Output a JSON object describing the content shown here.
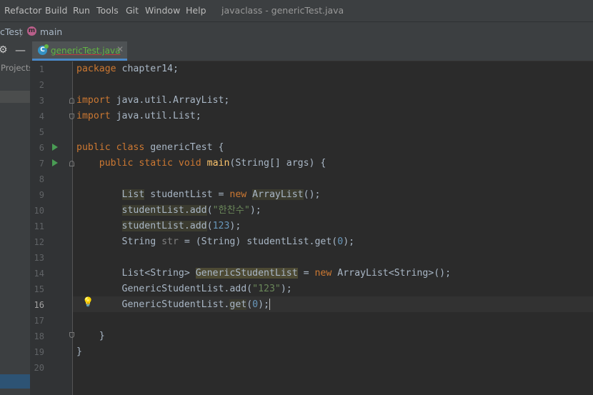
{
  "menu": {
    "items": [
      "Refactor",
      "Build",
      "Run",
      "Tools",
      "Git",
      "Window",
      "Help"
    ],
    "window_title": "javaclass - genericTest.java"
  },
  "breadcrumb": {
    "class": "cTest",
    "method": "main"
  },
  "toolwindow": {
    "label": "Projects"
  },
  "editor": {
    "tab_name": "genericTest.java",
    "line_numbers": [
      "1",
      "2",
      "3",
      "4",
      "5",
      "6",
      "7",
      "8",
      "9",
      "10",
      "11",
      "12",
      "13",
      "14",
      "15",
      "16",
      "17",
      "18",
      "19",
      "20"
    ],
    "current_line": 16
  },
  "code": {
    "l1_kw": "package",
    "l1_rest": " chapter14;",
    "l3_kw": "import",
    "l3_rest": " java.util.ArrayList;",
    "l4_kw": "import",
    "l4_rest": " java.util.List;",
    "l6_kw": "public class",
    "l6_rest": " genericTest {",
    "l7_kw": "    public static void ",
    "l7_fn": "main",
    "l7_rest": "(String[] args) {",
    "l9_a": "        ",
    "l9_b": "List",
    "l9_c": " studentList = ",
    "l9_d": "new ",
    "l9_e": "ArrayList",
    "l9_f": "();",
    "l10_a": "        ",
    "l10_b": "studentList.add",
    "l10_c": "(",
    "l10_d": "\"한찬수\"",
    "l10_e": ");",
    "l11_a": "        ",
    "l11_b": "studentList.add",
    "l11_c": "(",
    "l11_d": "123",
    "l11_e": ");",
    "l12_a": "        String ",
    "l12_b": "str",
    "l12_c": " = (String) studentList.get(",
    "l12_d": "0",
    "l12_e": ");",
    "l14_a": "        List<String> ",
    "l14_b": "GenericStudentList",
    "l14_c": " = ",
    "l14_d": "new ",
    "l14_e": "ArrayList<String>();",
    "l15_a": "        GenericStudentList.add(",
    "l15_b": "\"123\"",
    "l15_c": ");",
    "l16_a": "        GenericStudentList.",
    "l16_b": "get",
    "l16_c": "(",
    "l16_d": "0",
    "l16_e": ");",
    "l18": "    }",
    "l19": "}"
  }
}
